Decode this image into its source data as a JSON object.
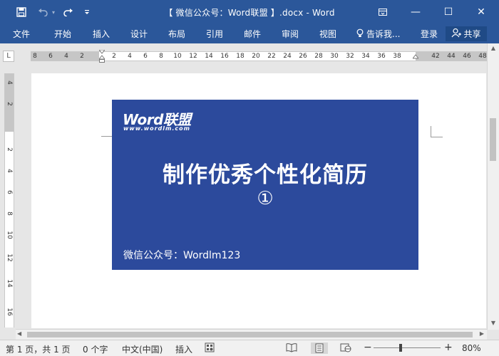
{
  "titlebar": {
    "doc_title": "【 微信公众号：Word联盟 】.docx - Word",
    "save_icon": "save-icon",
    "undo_icon": "undo-icon",
    "redo_icon": "redo-icon",
    "customize_icon": "customize-qat-icon",
    "ribbon_display_icon": "ribbon-display-options-icon",
    "minimize_symbol": "—",
    "maximize_symbol": "☐",
    "close_symbol": "✕"
  },
  "ribbon": {
    "tabs": [
      "文件",
      "开始",
      "插入",
      "设计",
      "布局",
      "引用",
      "邮件",
      "审阅",
      "视图"
    ],
    "tell_me": "告诉我...",
    "login": "登录",
    "share": "共享"
  },
  "ruler": {
    "corner": "L",
    "ticks": [
      "8",
      "6",
      "4",
      "2",
      "2",
      "4",
      "6",
      "8",
      "10",
      "12",
      "14",
      "16",
      "18",
      "20",
      "22",
      "24",
      "26",
      "28",
      "30",
      "32",
      "34",
      "36",
      "38",
      "42",
      "44",
      "46",
      "48"
    ],
    "vticks": [
      "4",
      "2",
      "2",
      "4",
      "6",
      "8",
      "10",
      "12",
      "14",
      "16"
    ]
  },
  "document": {
    "logo_text": "Word联盟",
    "logo_url": "www.wordlm.com",
    "headline": "制作优秀个性化简历",
    "number": "①",
    "footer": "微信公众号：Wordlm123",
    "banner_color": "#2c4a9c"
  },
  "statusbar": {
    "page": "第 1 页，共 1 页",
    "words": "0 个字",
    "language": "中文(中国)",
    "mode": "插入",
    "zoom_minus": "−",
    "zoom_plus": "+",
    "zoom": "80%"
  },
  "colors": {
    "accent": "#2b579a"
  }
}
